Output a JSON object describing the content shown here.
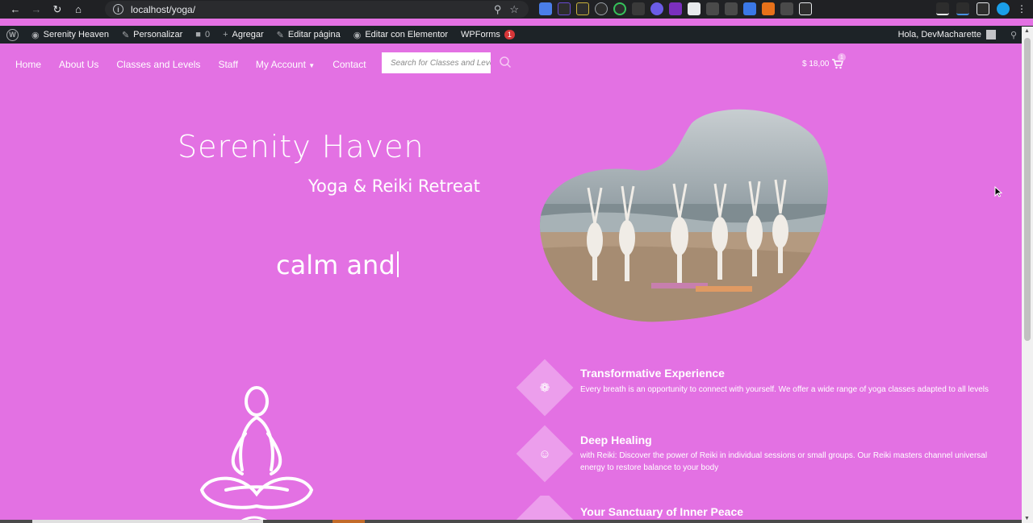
{
  "browser": {
    "url": "localhost/yoga/",
    "colors": {
      "bar": "#202124",
      "url_box": "#2a2b2e"
    }
  },
  "admin_bar": {
    "site_name": "Serenity Heaven",
    "customize": "Personalizar",
    "comments_count": "0",
    "add_new": "Agregar",
    "edit_page": "Editar página",
    "edit_elementor": "Editar con Elementor",
    "wpforms": "WPForms",
    "wpforms_badge": "1",
    "greeting": "Hola, DevMacharette"
  },
  "nav": {
    "items": [
      {
        "label": "Home"
      },
      {
        "label": "About Us"
      },
      {
        "label": "Classes and Levels"
      },
      {
        "label": "Staff"
      },
      {
        "label": "My Account"
      },
      {
        "label": "Contact"
      }
    ],
    "search_placeholder": "Search for Classes and Levels",
    "cart_total": "$ 18,00",
    "cart_count": "1"
  },
  "hero": {
    "title": "Serenity Haven",
    "subtitle": "Yoga & Reiki Retreat",
    "typed_text": "calm and"
  },
  "features": [
    {
      "title": "Transformative Experience",
      "text": "Every breath is an opportunity to connect with yourself. We offer a wide range of yoga classes adapted to all levels",
      "icon": "yoga-mat-icon"
    },
    {
      "title": "Deep Healing",
      "text": "with Reiki: Discover the power of Reiki in individual sessions or small groups. Our Reiki masters channel universal energy to restore balance to your body",
      "icon": "healing-hand-icon"
    },
    {
      "title": "Your Sanctuary of Inner Peace",
      "text": "",
      "icon": "lotus-icon"
    }
  ],
  "theme": {
    "background": "#e371e3",
    "diamond": "#ec9eec",
    "text": "#ffffff"
  }
}
